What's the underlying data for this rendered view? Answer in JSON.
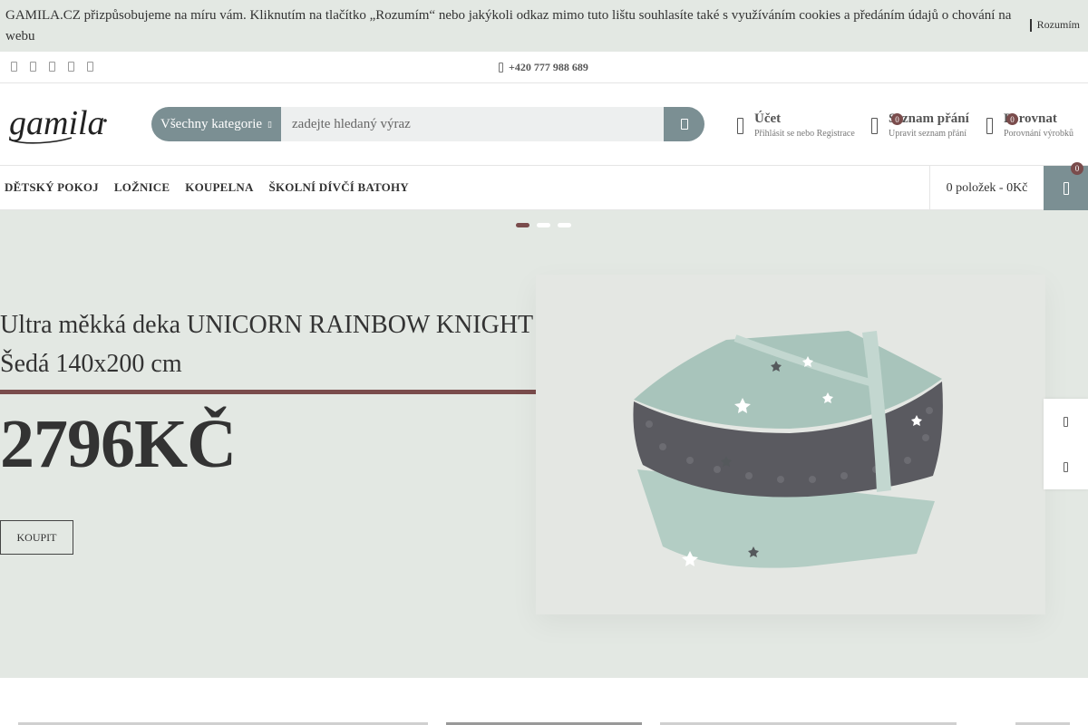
{
  "cookie": {
    "text": "GAMILA.CZ přizpůsobujeme na míru vám. Kliknutím na tlačítko „Rozumím“ nebo jakýkoli odkaz mimo tuto lištu souhlasíte také s využíváním cookies a předáním údajů o chování na webu",
    "accept_label": "Rozumím"
  },
  "topbar": {
    "social_icons": [
      "facebook-icon",
      "twitter-icon",
      "instagram-icon",
      "pinterest-icon",
      "youtube-icon"
    ],
    "phone": "+420 777 988 689"
  },
  "header": {
    "logo_text": "gamila",
    "search": {
      "category_label": "Všechny kategorie",
      "placeholder": "zadejte hledaný výraz"
    },
    "account": {
      "title": "Účet",
      "subtitle": "Přihlásit se nebo Registrace"
    },
    "wishlist": {
      "title": "Seznam přání",
      "subtitle": "Upravit seznam přání",
      "count": "0"
    },
    "compare": {
      "title": "Porovnat",
      "subtitle": "Porovnání výrobků",
      "count": "0"
    }
  },
  "nav": {
    "items": [
      "DĚTSKÝ POKOJ",
      "LOŽNICE",
      "KOUPELNA",
      "ŠKOLNÍ DÍVČÍ BATOHY"
    ],
    "cart_summary": "0 položek - 0Kč",
    "cart_count": "0"
  },
  "hero": {
    "title_line1": "Ultra měkká deka UNICORN RAINBOW KNIGHT",
    "title_line2": "Šedá 140x200 cm",
    "price": "2796KČ",
    "button_label": "KOUPIT",
    "slides": 3,
    "active_slide": 1
  },
  "colors": {
    "accent_slate": "#7b8f93",
    "accent_maroon": "#7a4c4c",
    "hero_bg": "#e3e8e3",
    "blanket_mint": "#a8c4bb",
    "blanket_grey": "#5a5a60"
  }
}
